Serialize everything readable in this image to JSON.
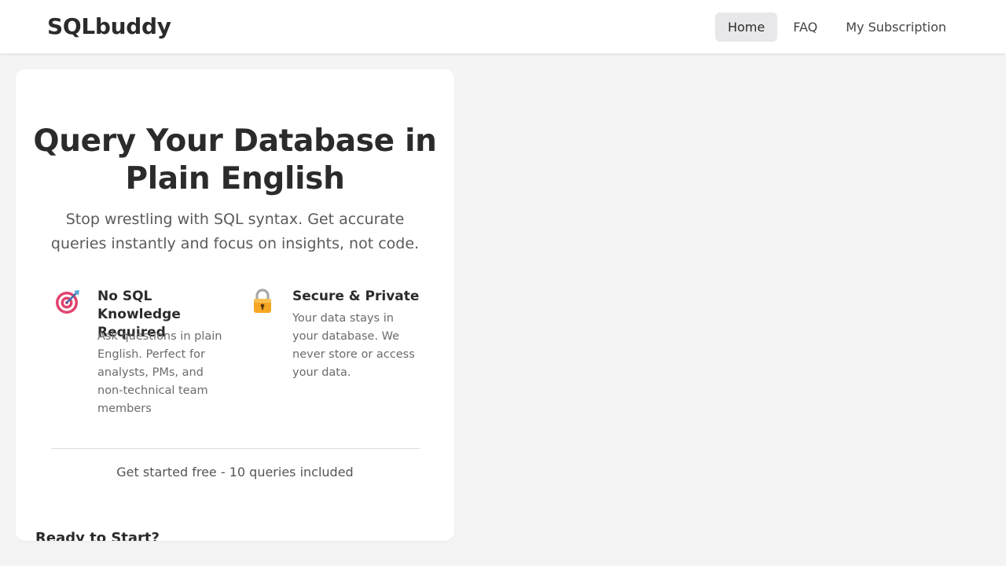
{
  "brand": {
    "name": "SQLbuddy"
  },
  "nav": {
    "items": [
      {
        "label": "Home",
        "active": true
      },
      {
        "label": "FAQ",
        "active": false
      },
      {
        "label": "My Subscription",
        "active": false
      }
    ]
  },
  "hero": {
    "title": "Query Your Database in Plain English",
    "subtitle": "Stop wrestling with SQL syntax. Get accurate queries instantly and focus on insights, not code."
  },
  "features": [
    {
      "icon": "target-icon",
      "title": "No SQL Knowledge Required",
      "description": "Ask questions in plain English. Perfect for analysts, PMs, and non-technical team members"
    },
    {
      "icon": "lock-icon",
      "title": "Secure & Private",
      "description": "Your data stays in your database. We never store or access your data."
    }
  ],
  "cta": {
    "note": "Get started free - 10 queries included"
  },
  "next_section": {
    "heading": "Ready to Start?"
  },
  "colors": {
    "page_bg": "#f4f4f4",
    "header_bg": "#ffffff",
    "card_bg": "#ffffff",
    "active_nav_bg": "#e8e8ea",
    "text_primary": "#2b2b2b",
    "text_muted": "#6b6b6b"
  }
}
